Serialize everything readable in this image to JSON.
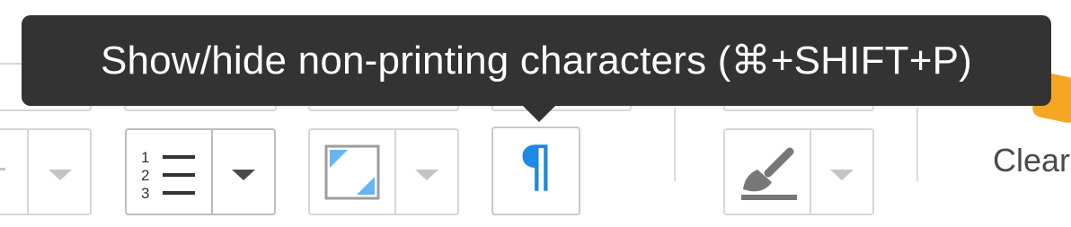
{
  "tooltip": {
    "text": "Show/hide non-printing characters (⌘+SHIFT+P)"
  },
  "toolbar": {
    "numbered_list": {
      "numbers": [
        "1",
        "2",
        "3"
      ],
      "icon": "numbered-list-icon",
      "dropdown_icon": "chevron-down-icon"
    },
    "text_direction": {
      "icon": "text-direction-icon",
      "dropdown_icon": "chevron-down-icon"
    },
    "non_printing": {
      "glyph": "¶",
      "icon": "pilcrow-icon",
      "active": true
    },
    "highlight": {
      "icon": "highlighter-icon",
      "dropdown_icon": "chevron-down-icon"
    },
    "clear": {
      "label": "Clear",
      "icon": "clear-formatting-icon"
    }
  },
  "colors": {
    "tooltip_bg": "#333333",
    "accent_blue": "#1e88e5",
    "light_blue": "#64b5f6",
    "border": "#d6d6d6",
    "icon_dark": "#333333"
  }
}
